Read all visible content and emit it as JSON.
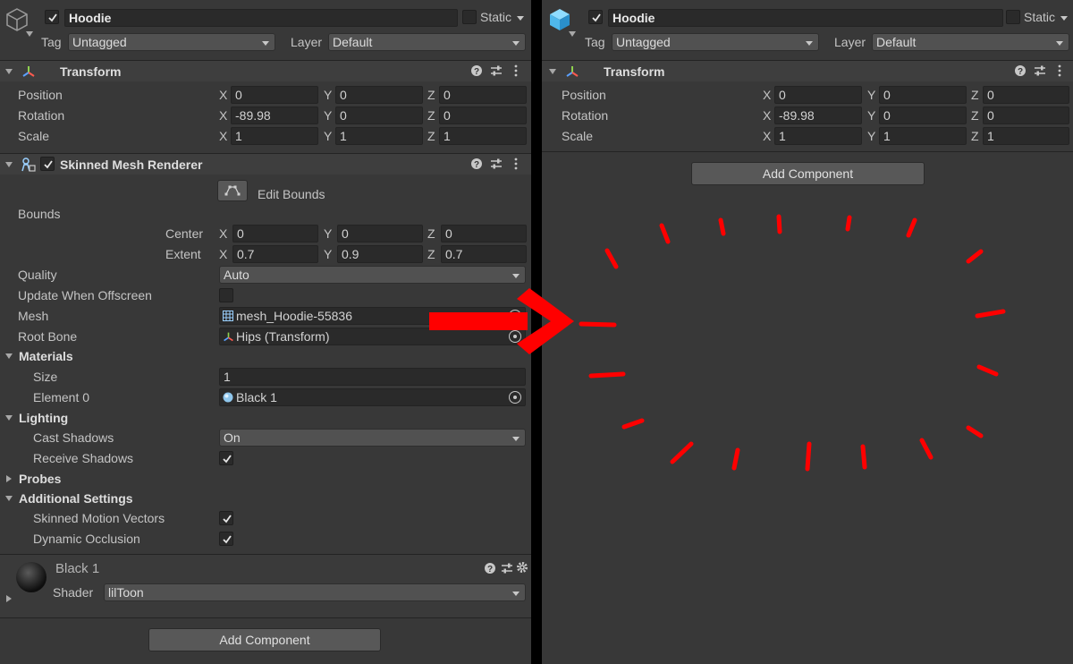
{
  "left": {
    "object": {
      "name": "Hoodie",
      "static_label": "Static",
      "tag_label": "Tag",
      "tag_value": "Untagged",
      "layer_label": "Layer",
      "layer_value": "Default"
    },
    "transform": {
      "title": "Transform",
      "position_label": "Position",
      "rotation_label": "Rotation",
      "scale_label": "Scale",
      "position": {
        "x": "0",
        "y": "0",
        "z": "0"
      },
      "rotation": {
        "x": "-89.98",
        "y": "0",
        "z": "0"
      },
      "scale": {
        "x": "1",
        "y": "1",
        "z": "1"
      }
    },
    "smr": {
      "title": "Skinned Mesh Renderer",
      "edit_bounds_label": "Edit Bounds",
      "bounds_label": "Bounds",
      "center_label": "Center",
      "extent_label": "Extent",
      "center": {
        "x": "0",
        "y": "0",
        "z": "0"
      },
      "extent": {
        "x": "0.7",
        "y": "0.9",
        "z": "0.7"
      },
      "quality_label": "Quality",
      "quality_value": "Auto",
      "update_offscreen_label": "Update When Offscreen",
      "mesh_label": "Mesh",
      "mesh_value": "mesh_Hoodie-55836",
      "root_bone_label": "Root Bone",
      "root_bone_value": "Hips (Transform)",
      "materials_label": "Materials",
      "size_label": "Size",
      "size_value": "1",
      "element0_label": "Element 0",
      "element0_value": "Black 1",
      "lighting_label": "Lighting",
      "cast_shadows_label": "Cast Shadows",
      "cast_shadows_value": "On",
      "receive_shadows_label": "Receive Shadows",
      "probes_label": "Probes",
      "additional_label": "Additional Settings",
      "motion_vectors_label": "Skinned Motion Vectors",
      "dynamic_occlusion_label": "Dynamic Occlusion"
    },
    "material": {
      "name": "Black 1",
      "shader_label": "Shader",
      "shader_value": "lilToon"
    },
    "add_component": "Add Component"
  },
  "right": {
    "object": {
      "name": "Hoodie",
      "static_label": "Static",
      "tag_label": "Tag",
      "tag_value": "Untagged",
      "layer_label": "Layer",
      "layer_value": "Default"
    },
    "transform": {
      "title": "Transform",
      "position_label": "Position",
      "rotation_label": "Rotation",
      "scale_label": "Scale",
      "position": {
        "x": "0",
        "y": "0",
        "z": "0"
      },
      "rotation": {
        "x": "-89.98",
        "y": "0",
        "z": "0"
      },
      "scale": {
        "x": "1",
        "y": "1",
        "z": "1"
      }
    },
    "add_component": "Add Component"
  },
  "axes": {
    "x": "X",
    "y": "Y",
    "z": "Z"
  },
  "icons": {
    "help": "help-icon",
    "presets": "presets-icon",
    "menu": "more-menu-icon",
    "settings": "gear-icon",
    "object_picker": "object-picker-icon",
    "transform": "transform-axes-icon",
    "cube": "cube-icon"
  },
  "colors": {
    "panel_bg": "#383838",
    "field_bg": "#2a2a2a",
    "annotation": "#ff0000",
    "cube_accent": "#5fc8f5"
  }
}
